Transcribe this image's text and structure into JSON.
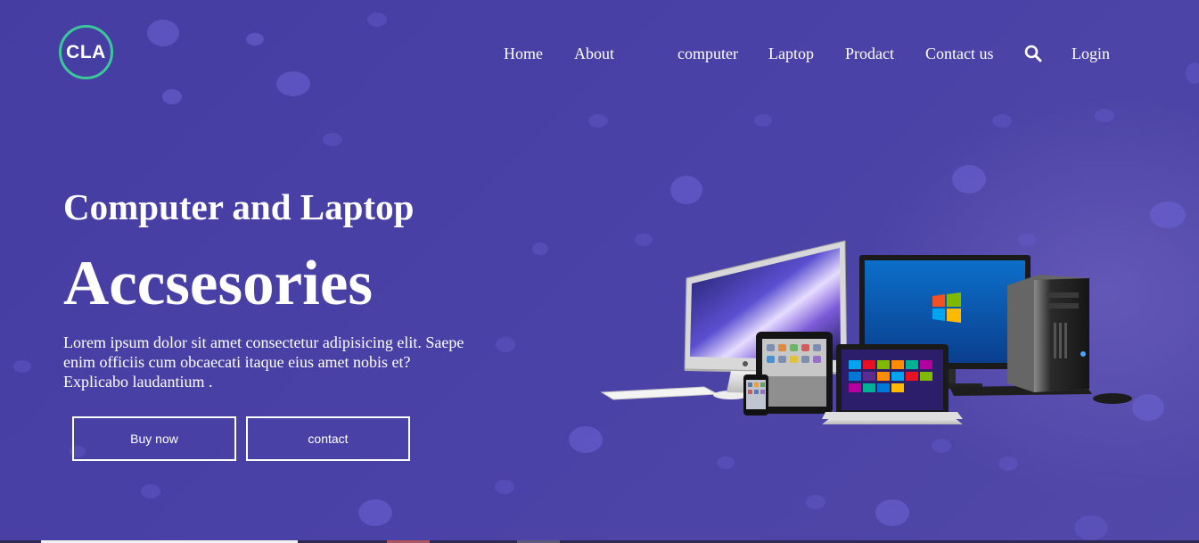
{
  "logo": {
    "text": "CLA",
    "ring_color": "#3cc79a"
  },
  "nav": {
    "items": [
      {
        "label": "Home"
      },
      {
        "label": "About"
      },
      {
        "label": "computer"
      },
      {
        "label": "Laptop"
      },
      {
        "label": "Prodact"
      },
      {
        "label": "Contact us"
      }
    ],
    "search_icon": "search-icon",
    "login_label": "Login"
  },
  "hero": {
    "title": "Computer and Laptop",
    "big_title": "Accsesories",
    "description": "Lorem ipsum dolor sit amet consectetur adipisicing elit. Saepe enim officiis cum obcaecati itaque eius amet nobis et? Explicabo laudantium .",
    "buttons": {
      "buy_label": "Buy now",
      "contact_label": "contact"
    }
  },
  "colors": {
    "background": "#4a41a0",
    "accent": "#3cc79a",
    "text": "#ffffff"
  }
}
